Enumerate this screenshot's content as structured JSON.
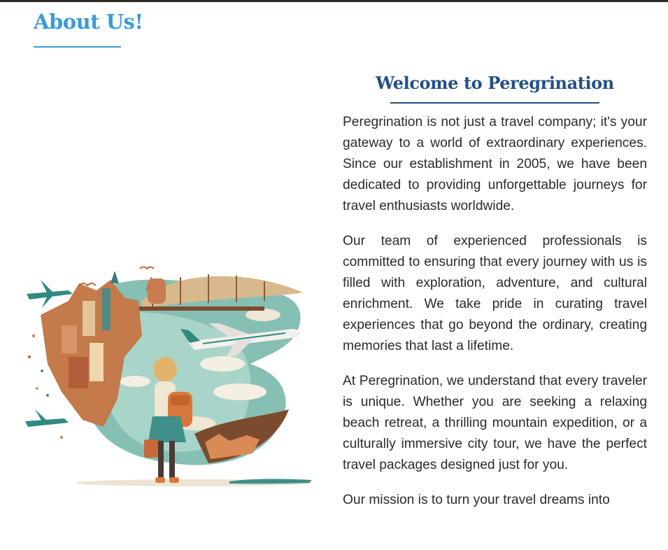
{
  "about": {
    "heading": "About Us!"
  },
  "welcome": {
    "title": "Welcome to Peregrination"
  },
  "paragraphs": [
    "Peregrination is not just a travel company; it's your gateway to a world of extraordinary experiences. Since our establishment in 2005, we have been dedicated to providing unforgettable journeys for travel enthusiasts worldwide.",
    "Our team of experienced professionals is committed to ensuring that every journey with us is filled with exploration, adventure, and cultural enrichment. We take pride in curating travel experiences that go beyond the ordinary, creating memories that last a lifetime.",
    "At Peregrination, we understand that every traveler is unique. Whether you are seeking a relaxing beach retreat, a thrilling mountain expedition, or a culturally immersive city tour, we have the perfect travel packages designed just for you.",
    "Our mission is to turn your travel dreams into"
  ],
  "colors": {
    "heading_blue": "#3a9bd5",
    "title_navy": "#224f86",
    "body_text": "#2b2b2b",
    "top_bar": "#2e2a27"
  }
}
